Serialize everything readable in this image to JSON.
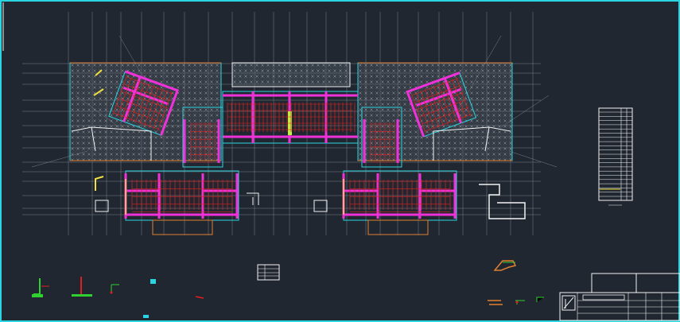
{
  "drawing": {
    "background": "#212730",
    "colors": {
      "frame": "#2ad4e0",
      "grid": "#8e96a0",
      "wall": "#f030d8",
      "column": "#f030d8",
      "rebar": "#e02020",
      "beam": "#2ad4e0",
      "slab_hatch": "#9aa3ad",
      "yellow": "#f0e040",
      "white": "#f2f2f2",
      "green": "#30d030",
      "orange": "#e08030"
    },
    "title_block": {
      "label": ""
    }
  }
}
